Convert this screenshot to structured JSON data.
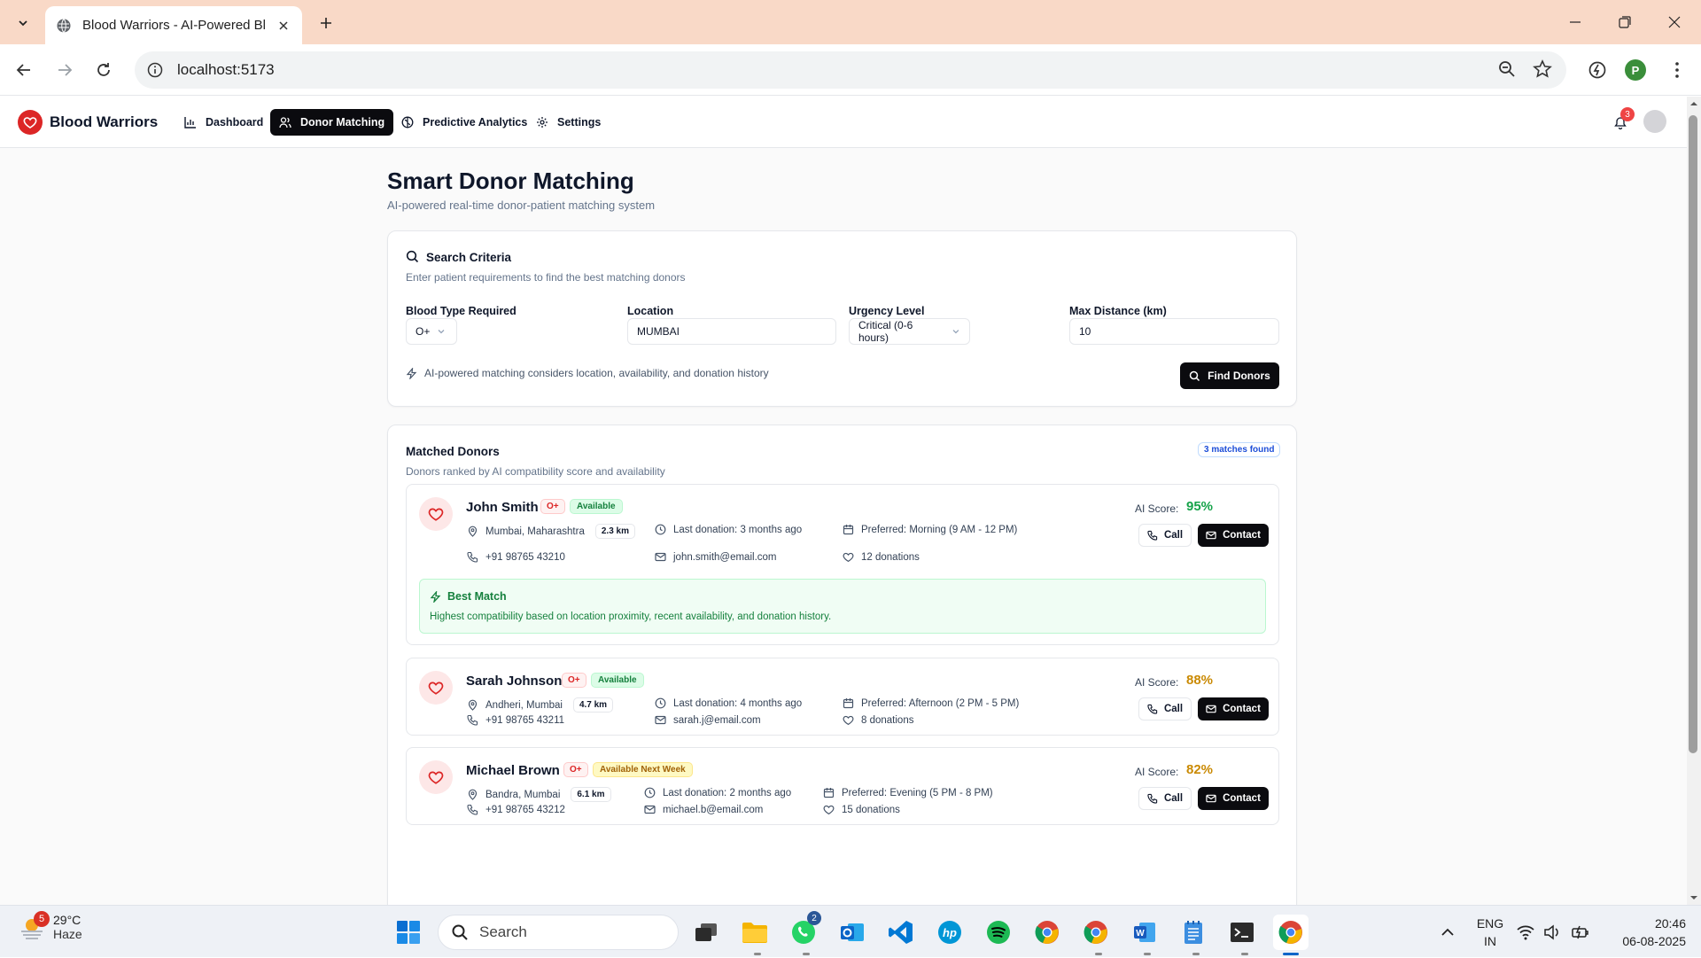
{
  "browser": {
    "tab_title": "Blood Warriors - AI-Powered Bl",
    "url": "localhost:5173",
    "profile_initial": "P"
  },
  "app": {
    "brand": "Blood Warriors",
    "nav": [
      {
        "label": "Dashboard",
        "icon": "bar-chart-icon"
      },
      {
        "label": "Donor Matching",
        "icon": "users-icon",
        "active": true
      },
      {
        "label": "Predictive Analytics",
        "icon": "brain-icon"
      },
      {
        "label": "Settings",
        "icon": "gear-icon"
      }
    ],
    "notification_count": "3",
    "accent": "#dc2626"
  },
  "page": {
    "title": "Smart Donor Matching",
    "subtitle": "AI-powered real-time donor-patient matching system"
  },
  "search": {
    "title": "Search Criteria",
    "subtitle": "Enter patient requirements to find the best matching donors",
    "blood_type_label": "Blood Type Required",
    "blood_type_value": "O+",
    "location_label": "Location",
    "location_value": "MUMBAI",
    "urgency_label": "Urgency Level",
    "urgency_value": "Critical (0-6 hours)",
    "distance_label": "Max Distance (km)",
    "distance_value": "10",
    "hint": "AI-powered matching considers location, availability, and donation history",
    "find_button": "Find Donors"
  },
  "results": {
    "title": "Matched Donors",
    "subtitle": "Donors ranked by AI compatibility score and availability",
    "count_badge": "3 matches found",
    "score_label": "AI Score:",
    "call_label": "Call",
    "contact_label": "Contact",
    "best_match_title": "Best Match",
    "best_match_text": "Highest compatibility based on location proximity, recent availability, and donation history.",
    "donors": [
      {
        "name": "John Smith",
        "blood": "O+",
        "availability": "Available",
        "location": "Mumbai, Maharashtra",
        "distance": "2.3 km",
        "last_donation": "Last donation: 3 months ago",
        "preferred": "Preferred: Morning (9 AM - 12 PM)",
        "phone": "+91 98765 43210",
        "email": "john.smith@email.com",
        "donations": "12 donations",
        "score": "95%",
        "score_color": "#16a34a"
      },
      {
        "name": "Sarah Johnson",
        "blood": "O+",
        "availability": "Available",
        "location": "Andheri, Mumbai",
        "distance": "4.7 km",
        "last_donation": "Last donation: 4 months ago",
        "preferred": "Preferred: Afternoon (2 PM - 5 PM)",
        "phone": "+91 98765 43211",
        "email": "sarah.j@email.com",
        "donations": "8 donations",
        "score": "88%",
        "score_color": "#ca8a04"
      },
      {
        "name": "Michael Brown",
        "blood": "O+",
        "availability": "Available Next Week",
        "location": "Bandra, Mumbai",
        "distance": "6.1 km",
        "last_donation": "Last donation: 2 months ago",
        "preferred": "Preferred: Evening (5 PM - 8 PM)",
        "phone": "+91 98765 43212",
        "email": "michael.b@email.com",
        "donations": "15 donations",
        "score": "82%",
        "score_color": "#ca8a04"
      }
    ]
  },
  "taskbar": {
    "weather_temp": "29°C",
    "weather_desc": "Haze",
    "weather_badge": "5",
    "search_placeholder": "Search",
    "whatsapp_badge": "2",
    "lang_top": "ENG",
    "lang_bottom": "IN",
    "time": "20:46",
    "date": "06-08-2025"
  }
}
